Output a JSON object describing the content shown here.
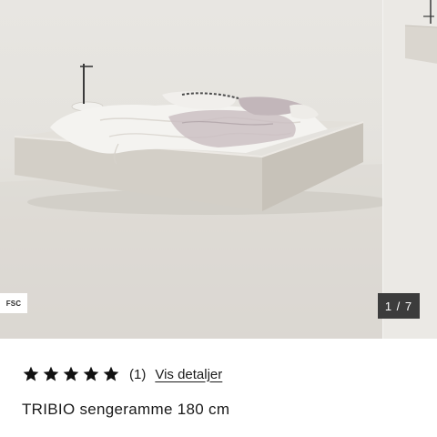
{
  "gallery": {
    "fsc_badge": "FSC",
    "counter": "1 / 7"
  },
  "rating": {
    "stars_filled": 5,
    "stars_total": 5,
    "count_label": "(1)",
    "details_link": "Vis detaljer",
    "star_icon": "star-icon",
    "star_color": "#111111"
  },
  "product": {
    "title": "TRIBIO sengeramme 180 cm"
  }
}
